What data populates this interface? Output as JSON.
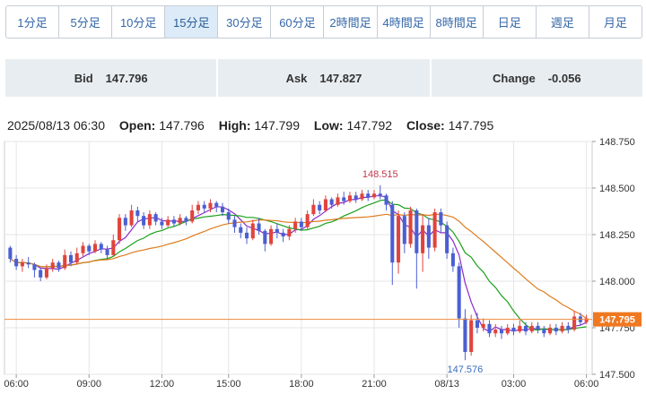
{
  "tabs": [
    {
      "label": "1分足",
      "active": false
    },
    {
      "label": "5分足",
      "active": false
    },
    {
      "label": "10分足",
      "active": false
    },
    {
      "label": "15分足",
      "active": true
    },
    {
      "label": "30分足",
      "active": false
    },
    {
      "label": "60分足",
      "active": false
    },
    {
      "label": "2時間足",
      "active": false
    },
    {
      "label": "4時間足",
      "active": false
    },
    {
      "label": "8時間足",
      "active": false
    },
    {
      "label": "日足",
      "active": false
    },
    {
      "label": "週足",
      "active": false
    },
    {
      "label": "月足",
      "active": false
    }
  ],
  "quote": {
    "bid_label": "Bid",
    "bid_value": "147.796",
    "ask_label": "Ask",
    "ask_value": "147.827",
    "change_label": "Change",
    "change_value": "-0.056"
  },
  "ohlc": {
    "datetime": "2025/08/13 06:30",
    "open_label": "Open:",
    "open": "147.796",
    "high_label": "High:",
    "high": "147.799",
    "low_label": "Low:",
    "low": "147.792",
    "close_label": "Close:",
    "close": "147.795"
  },
  "colors": {
    "up": "#e0443c",
    "down": "#4a5fd2",
    "ma_short": "#8c2cc8",
    "ma_mid": "#1aa01a",
    "ma_long": "#e07a1c",
    "last_price_line": "#f08a3c",
    "last_price_tag": "#f07820",
    "grid": "#e6e6e6",
    "plot_border": "#cccccc"
  },
  "chart_data": {
    "type": "candlestick",
    "ylim": [
      147.5,
      148.75
    ],
    "yticks": [
      "148.750",
      "148.500",
      "148.250",
      "148.000",
      "147.750",
      "147.500"
    ],
    "xticks": [
      "06:00",
      "09:00",
      "12:00",
      "15:00",
      "18:00",
      "21:00",
      "08/13",
      "03:00",
      "06:00"
    ],
    "grid": true,
    "high_annotation": "148.515",
    "low_annotation": "147.576",
    "last_price": "147.795",
    "candles": [
      [
        148.18,
        148.12,
        148.19,
        148.1
      ],
      [
        148.12,
        148.08,
        148.14,
        148.06
      ],
      [
        148.08,
        148.1,
        148.12,
        148.05
      ],
      [
        148.1,
        148.09,
        148.13,
        148.07
      ],
      [
        148.09,
        148.06,
        148.1,
        148.02
      ],
      [
        148.06,
        148.02,
        148.07,
        148.0
      ],
      [
        148.02,
        148.07,
        148.09,
        148.01
      ],
      [
        148.07,
        148.1,
        148.12,
        148.05
      ],
      [
        148.1,
        148.07,
        148.11,
        148.05
      ],
      [
        148.07,
        148.14,
        148.17,
        148.06
      ],
      [
        148.14,
        148.1,
        148.16,
        148.08
      ],
      [
        148.1,
        148.15,
        148.18,
        148.09
      ],
      [
        148.15,
        148.19,
        148.21,
        148.13
      ],
      [
        148.19,
        148.16,
        148.2,
        148.14
      ],
      [
        148.16,
        148.2,
        148.22,
        148.15
      ],
      [
        148.2,
        148.17,
        148.21,
        148.15
      ],
      [
        148.17,
        148.14,
        148.19,
        148.12
      ],
      [
        148.14,
        148.22,
        148.25,
        148.13
      ],
      [
        148.22,
        148.34,
        148.36,
        148.2
      ],
      [
        148.34,
        148.3,
        148.36,
        148.27
      ],
      [
        148.3,
        148.38,
        148.41,
        148.29
      ],
      [
        148.38,
        148.35,
        148.4,
        148.32
      ],
      [
        148.35,
        148.3,
        148.37,
        148.28
      ],
      [
        148.3,
        148.36,
        148.38,
        148.28
      ],
      [
        148.36,
        148.32,
        148.37,
        148.3
      ],
      [
        148.32,
        148.3,
        148.34,
        148.28
      ],
      [
        148.3,
        148.33,
        148.35,
        148.29
      ],
      [
        148.33,
        148.31,
        148.35,
        148.29
      ],
      [
        148.31,
        148.34,
        148.36,
        148.3
      ],
      [
        148.34,
        148.32,
        148.35,
        148.3
      ],
      [
        148.32,
        148.38,
        148.41,
        148.31
      ],
      [
        148.38,
        148.41,
        148.43,
        148.36
      ],
      [
        148.41,
        148.39,
        148.43,
        148.37
      ],
      [
        148.39,
        148.42,
        148.44,
        148.37
      ],
      [
        148.42,
        148.4,
        148.43,
        148.37
      ],
      [
        148.4,
        148.37,
        148.42,
        148.35
      ],
      [
        148.37,
        148.33,
        148.39,
        148.31
      ],
      [
        148.33,
        148.29,
        148.35,
        148.26
      ],
      [
        148.29,
        148.26,
        148.31,
        148.23
      ],
      [
        148.26,
        148.23,
        148.29,
        148.2
      ],
      [
        148.23,
        148.31,
        148.33,
        148.22
      ],
      [
        148.31,
        148.27,
        148.34,
        148.25
      ],
      [
        148.27,
        148.2,
        148.28,
        148.16
      ],
      [
        148.2,
        148.28,
        148.3,
        148.19
      ],
      [
        148.28,
        148.26,
        148.31,
        148.23
      ],
      [
        148.26,
        148.24,
        148.28,
        148.21
      ],
      [
        148.24,
        148.28,
        148.3,
        148.22
      ],
      [
        148.28,
        148.32,
        148.34,
        148.26
      ],
      [
        148.32,
        148.29,
        148.34,
        148.27
      ],
      [
        148.29,
        148.36,
        148.38,
        148.28
      ],
      [
        148.36,
        148.41,
        148.44,
        148.35
      ],
      [
        148.41,
        148.38,
        148.43,
        148.36
      ],
      [
        148.38,
        148.44,
        148.46,
        148.37
      ],
      [
        148.44,
        148.41,
        148.45,
        148.39
      ],
      [
        148.41,
        148.45,
        148.47,
        148.4
      ],
      [
        148.45,
        148.43,
        148.48,
        148.41
      ],
      [
        148.43,
        148.46,
        148.48,
        148.42
      ],
      [
        148.46,
        148.44,
        148.48,
        148.42
      ],
      [
        148.44,
        148.47,
        148.49,
        148.43
      ],
      [
        148.47,
        148.45,
        148.49,
        148.43
      ],
      [
        148.45,
        148.47,
        148.49,
        148.44
      ],
      [
        148.47,
        148.46,
        148.515,
        148.44
      ],
      [
        148.46,
        148.41,
        148.47,
        148.38
      ],
      [
        148.41,
        148.1,
        148.43,
        147.98
      ],
      [
        148.1,
        148.35,
        148.38,
        148.04
      ],
      [
        148.35,
        148.2,
        148.37,
        148.15
      ],
      [
        148.2,
        148.38,
        148.4,
        148.18
      ],
      [
        148.38,
        148.15,
        148.39,
        147.96
      ],
      [
        148.15,
        148.3,
        148.36,
        148.05
      ],
      [
        148.3,
        148.18,
        148.34,
        148.12
      ],
      [
        148.18,
        148.37,
        148.39,
        148.16
      ],
      [
        148.37,
        148.3,
        148.39,
        148.26
      ],
      [
        148.3,
        148.15,
        148.32,
        148.12
      ],
      [
        148.15,
        148.08,
        148.18,
        148.05
      ],
      [
        148.08,
        147.8,
        148.1,
        147.75
      ],
      [
        147.8,
        147.62,
        147.85,
        147.576
      ],
      [
        147.62,
        147.79,
        147.82,
        147.6
      ],
      [
        147.79,
        147.75,
        147.83,
        147.72
      ],
      [
        147.75,
        147.77,
        147.8,
        147.73
      ],
      [
        147.77,
        147.72,
        147.79,
        147.7
      ],
      [
        147.72,
        147.74,
        147.77,
        147.7
      ],
      [
        147.74,
        147.72,
        147.76,
        147.69
      ],
      [
        147.72,
        147.75,
        147.77,
        147.71
      ],
      [
        147.75,
        147.73,
        147.77,
        147.71
      ],
      [
        147.73,
        147.76,
        147.79,
        147.72
      ],
      [
        147.76,
        147.73,
        147.78,
        147.71
      ],
      [
        147.73,
        147.76,
        147.78,
        147.72
      ],
      [
        147.76,
        147.74,
        147.78,
        147.72
      ],
      [
        147.74,
        147.72,
        147.76,
        147.7
      ],
      [
        147.72,
        147.75,
        147.77,
        147.71
      ],
      [
        147.75,
        147.73,
        147.77,
        147.71
      ],
      [
        147.73,
        147.76,
        147.78,
        147.72
      ],
      [
        147.76,
        147.74,
        147.78,
        147.72
      ],
      [
        147.74,
        147.81,
        147.84,
        147.73
      ],
      [
        147.81,
        147.78,
        147.83,
        147.76
      ],
      [
        147.78,
        147.8,
        147.82,
        147.77
      ]
    ]
  }
}
